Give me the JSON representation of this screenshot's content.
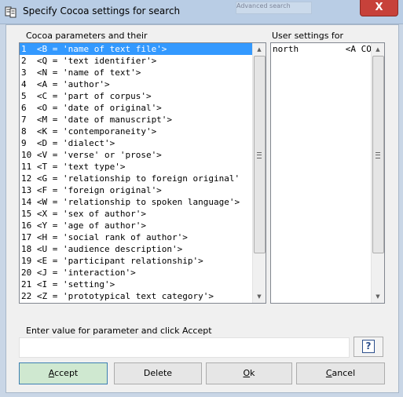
{
  "window": {
    "title": "Specify Cocoa settings for search",
    "close_glyph": "X",
    "background_hint": "Advanced search"
  },
  "cocoa_params": {
    "label": "Cocoa parameters and their",
    "items": [
      "1  <B = 'name of text file'>",
      "2  <Q = 'text identifier'>",
      "3  <N = 'name of text'>",
      "4  <A = 'author'>",
      "5  <C = 'part of corpus'>",
      "6  <O = 'date of original'>",
      "7  <M = 'date of manuscript'>",
      "8  <K = 'contemporaneity'>",
      "9  <D = 'dialect'>",
      "10 <V = 'verse' or 'prose'>",
      "11 <T = 'text type'>",
      "12 <G = 'relationship to foreign original'",
      "13 <F = 'foreign original'>",
      "14 <W = 'relationship to spoken language'>",
      "15 <X = 'sex of author'>",
      "16 <Y = 'age of author'>",
      "17 <H = 'social rank of author'>",
      "18 <U = 'audience description'>",
      "19 <E = 'participant relationship'>",
      "20 <J = 'interaction'>",
      "21 <I = 'setting'>",
      "22 <Z = 'prototypical text category'>"
    ],
    "selected_index": 0
  },
  "user_settings": {
    "label": "User settings for",
    "items": [
      "north         <A COLVIL"
    ]
  },
  "value_entry": {
    "label": "Enter value for parameter and click Accept",
    "value": "",
    "help_glyph": "?"
  },
  "buttons": {
    "accept": {
      "mnemonic": "A",
      "rest": "ccept"
    },
    "delete": {
      "label": "Delete"
    },
    "ok": {
      "mnemonic": "O",
      "rest": "k"
    },
    "cancel": {
      "mnemonic": "C",
      "rest": "ancel"
    }
  }
}
